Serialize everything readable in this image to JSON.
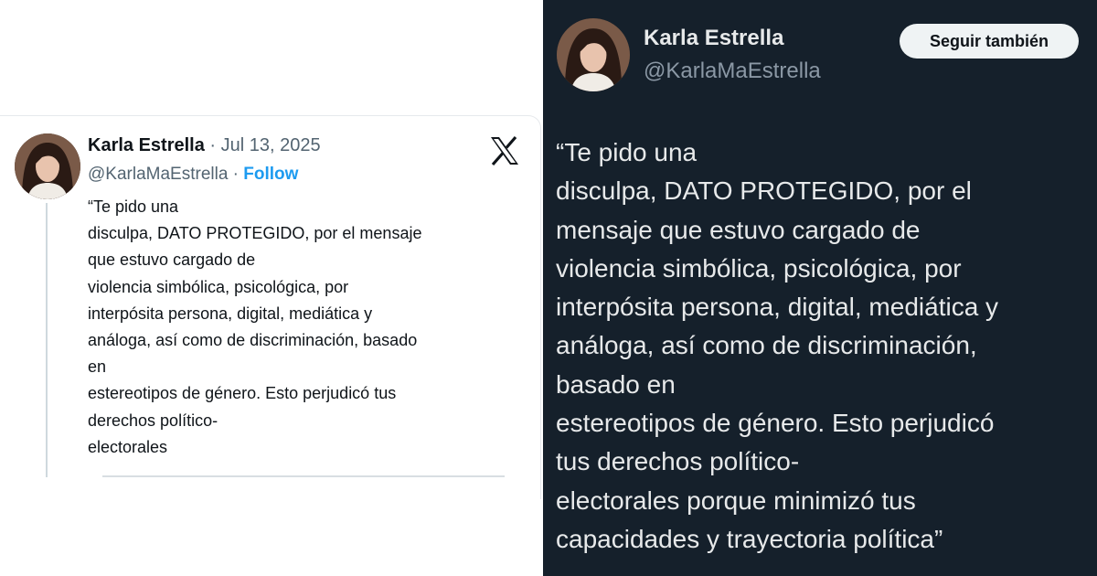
{
  "light_tweet": {
    "name": "Karla Estrella",
    "date": "· Jul 13, 2025",
    "handle": "@KarlaMaEstrella ·",
    "follow_label": "Follow",
    "lines": [
      "“Te pido una",
      "disculpa, DATO PROTEGIDO, por el mensaje",
      "que estuvo cargado de",
      "violencia simbólica, psicológica, por",
      "interpósita persona, digital, mediática y",
      "análoga, así como de discriminación, basado",
      "en",
      "estereotipos de género. Esto perjudicó tus",
      "derechos político-",
      "electorales"
    ],
    "icons": {
      "logo": "x-logo-icon"
    }
  },
  "dark_tweet": {
    "name": "Karla Estrella",
    "handle": "@KarlaMaEstrella",
    "follow_label": "Seguir también",
    "lines": [
      "“Te pido una",
      "disculpa, DATO PROTEGIDO, por el",
      "mensaje que estuvo cargado de",
      "violencia simbólica, psicológica, por",
      "interpósita persona, digital, mediática y",
      "análoga, así como de discriminación,",
      "basado en",
      "estereotipos de género. Esto perjudicó",
      "tus derechos político-",
      "electorales porque minimizó tus",
      "capacidades y trayectoria política”"
    ]
  },
  "colors": {
    "dark_background": "#15202b",
    "follow_blue": "#1d9bf0",
    "light_text": "#0f1419",
    "dark_text": "#e7e9ea"
  }
}
